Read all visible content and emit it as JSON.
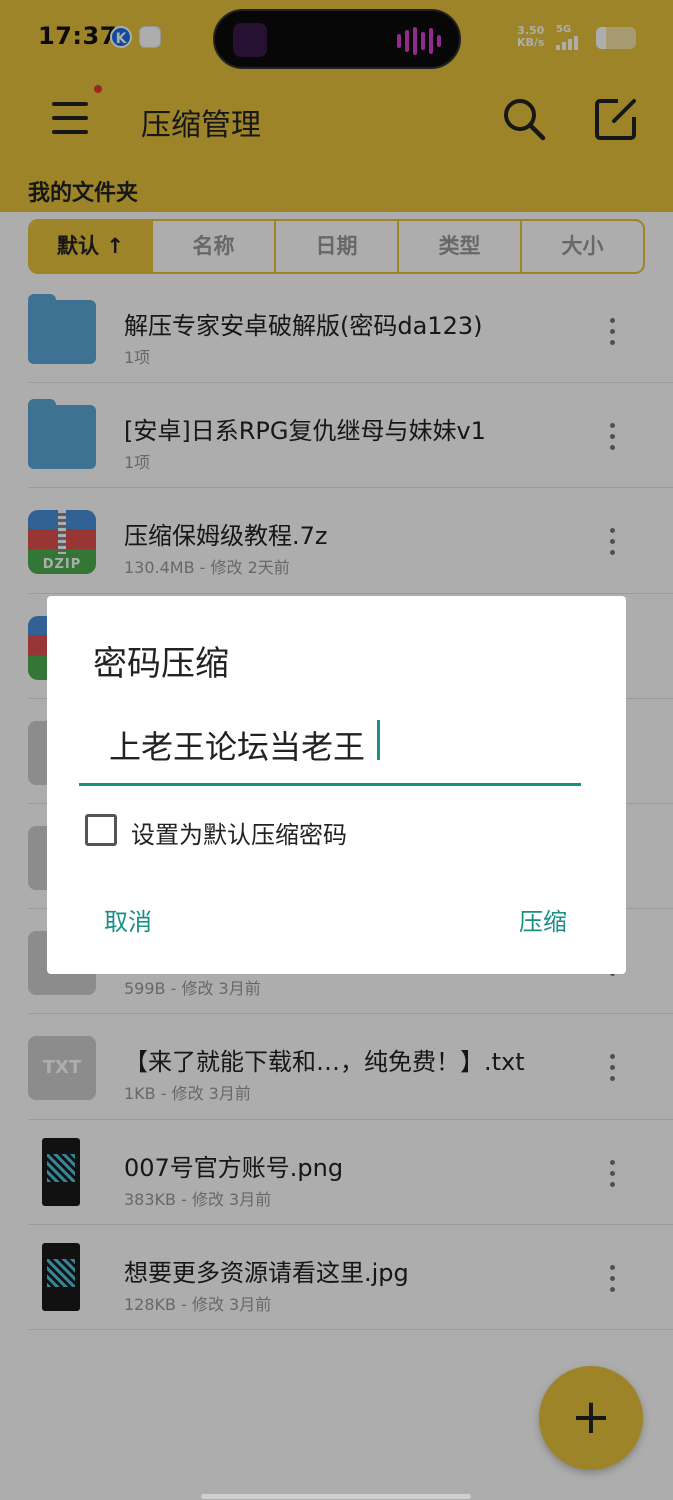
{
  "status_bar": {
    "time": "17:37",
    "app_icon_k": "K",
    "net_speed": "3.50",
    "net_unit": "KB/s",
    "network": "5G",
    "icons": [
      "k-app-icon",
      "baidu-app-icon",
      "media-thumbnail-icon",
      "audio-wave-icon",
      "signal-icon",
      "battery-icon"
    ]
  },
  "header": {
    "title": "压缩管理",
    "folder_heading": "我的文件夹",
    "color": "#e8c33c"
  },
  "sort_tabs": [
    {
      "label": "默认 ↑"
    },
    {
      "label": "名称"
    },
    {
      "label": "日期"
    },
    {
      "label": "类型"
    },
    {
      "label": "大小"
    }
  ],
  "files": [
    {
      "name": "解压专家安卓破解版(密码da123)",
      "meta": "1项",
      "icon": "folder-icon"
    },
    {
      "name": "[安卓]日系RPG复仇继母与妹妹v1",
      "meta": "1项",
      "icon": "folder-icon"
    },
    {
      "name": "压缩保姆级教程.7z",
      "meta": "130.4MB - 修改 2天前",
      "icon": "zip-icon",
      "icon_label": "DZIP"
    },
    {
      "name": "",
      "meta": "",
      "icon": "zip-icon",
      "icon_label": ""
    },
    {
      "name": "",
      "meta": "",
      "icon": "file-icon"
    },
    {
      "name": "",
      "meta": "",
      "icon": "file-icon"
    },
    {
      "name": "",
      "meta": "599B - 修改 3月前",
      "icon": "file-icon"
    },
    {
      "name": "【来了就能下载和…，纯免费！】.txt",
      "meta": "1KB - 修改 3月前",
      "icon": "txt-icon",
      "icon_label": "TXT"
    },
    {
      "name": "007号官方账号.png",
      "meta": "383KB - 修改 3月前",
      "icon": "image-icon"
    },
    {
      "name": "想要更多资源请看这里.jpg",
      "meta": "128KB - 修改 3月前",
      "icon": "image-icon"
    }
  ],
  "dialog": {
    "title": "密码压缩",
    "password_value": "上老王论坛当老王",
    "checkbox_label": "设置为默认压缩密码",
    "checkbox_checked": false,
    "cancel_label": "取消",
    "confirm_label": "压缩",
    "accent": "#1a8f84"
  },
  "fab": {
    "label": "+"
  }
}
